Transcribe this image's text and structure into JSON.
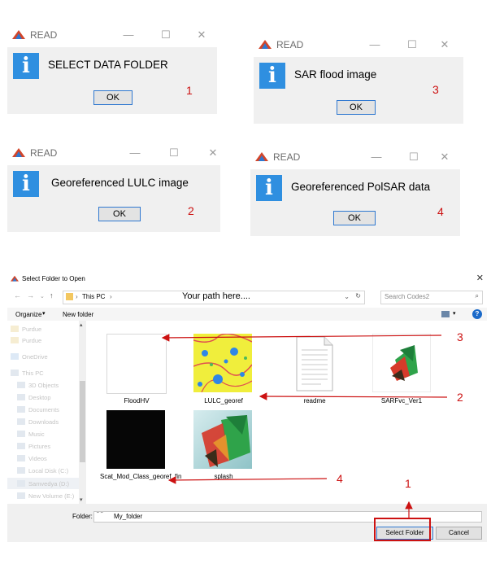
{
  "dialogs": [
    {
      "title": "READ",
      "message": "SELECT DATA FOLDER",
      "ok": "OK",
      "step": "1"
    },
    {
      "title": "READ",
      "message": "SAR flood image",
      "ok": "OK",
      "step": "3"
    },
    {
      "title": "READ",
      "message": "Georeferenced LULC image",
      "ok": "OK",
      "step": "2"
    },
    {
      "title": "READ",
      "message": "Georeferenced PolSAR data",
      "ok": "OK",
      "step": "4"
    }
  ],
  "folder_dialog": {
    "title": "Select Folder to Open",
    "breadcrumb": "This PC",
    "path_hint": "Your path here....",
    "search_placeholder": "Search Codes2",
    "organize": "Organize",
    "new_folder": "New folder",
    "nav_items": [
      "Purdue",
      "Purdue",
      "OneDrive",
      "This PC",
      "3D Objects",
      "Desktop",
      "Documents",
      "Downloads",
      "Music",
      "Pictures",
      "Videos",
      "Local Disk (C:)",
      "Samvedya (D:)",
      "New Volume (E:)"
    ],
    "files": [
      {
        "name": "FloodHV"
      },
      {
        "name": "LULC_georef"
      },
      {
        "name": "readme"
      },
      {
        "name": "SARFvc_Ver1"
      },
      {
        "name": "Scat_Mod_Class_georef_fin"
      },
      {
        "name": "splash"
      }
    ],
    "folder_label": "Folder:",
    "folder_value": "My_folder",
    "select_button": "Select Folder",
    "cancel_button": "Cancel"
  },
  "annotations": {
    "arrow_flood": "3",
    "arrow_lulc": "2",
    "arrow_scat": "4",
    "arrow_select": "1",
    "color": "#cc1111"
  }
}
